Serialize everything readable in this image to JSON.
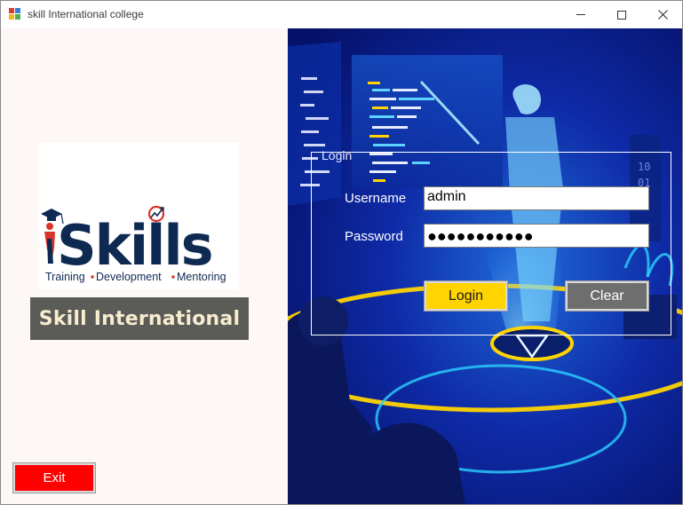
{
  "window": {
    "title": "skill International college"
  },
  "logo": {
    "wordmark": "iSkills",
    "tagline_parts": [
      "Training",
      "Development",
      "Mentoring"
    ],
    "colors": {
      "navy": "#0f2a52",
      "red": "#d8342a"
    }
  },
  "brand": {
    "name": "Skill International"
  },
  "login": {
    "group_title": "Login",
    "username_label": "Username",
    "username_value": "admin",
    "password_label": "Password",
    "password_value": "●●●●●●●●●●●",
    "login_label": "Login",
    "clear_label": "Clear"
  },
  "exit_label": "Exit",
  "colors": {
    "login_button": "#ffd400",
    "clear_button": "#6e6e6e",
    "exit_button": "#ff0000",
    "brand_bg": "#5b5b57",
    "brand_text": "#f7eccf"
  }
}
